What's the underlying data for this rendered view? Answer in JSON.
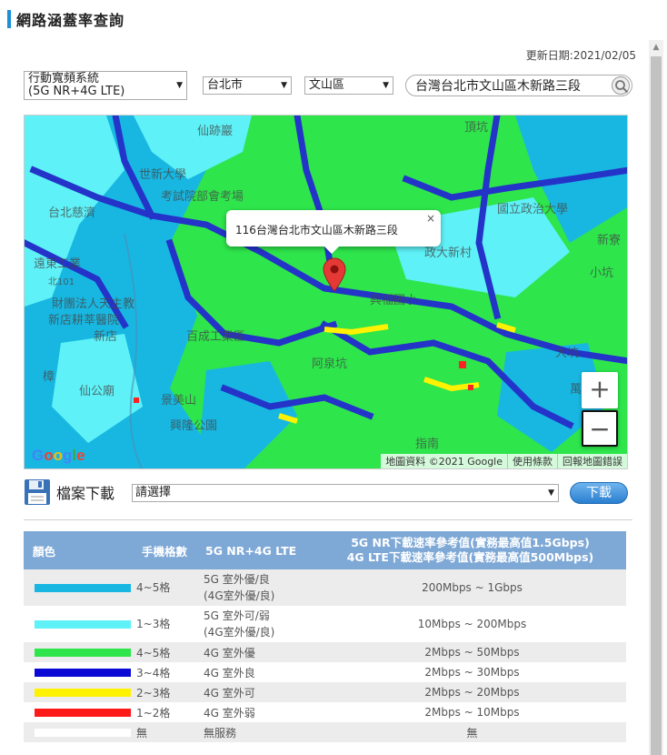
{
  "title": "網路涵蓋率查詢",
  "update_date": "更新日期:2021/02/05",
  "controls": {
    "system_line1": "行動寬頻系統",
    "system_line2": "(5G NR+4G LTE)",
    "city": "台北市",
    "district": "文山區",
    "search_value": "台灣台北市文山區木新路三段"
  },
  "map": {
    "popup_text": "116台灣台北市文山區木新路三段",
    "close_glyph": "×",
    "zoom_in": "+",
    "zoom_out": "−",
    "google_logo": "Google",
    "attribution": [
      "地圖資料 ©2021 Google",
      "使用條款",
      "回報地圖錯誤"
    ],
    "labels": [
      "仙跡巖",
      "世新大學",
      "考試院部會考場",
      "台北慈濟",
      "國立政治大學",
      "遠東工業",
      "北101",
      "財團法人天主教",
      "新店耕莘醫院",
      "新店",
      "政大新村",
      "小坑",
      "新寮",
      "大坑",
      "興福國小",
      "萬芳",
      "仙公廟",
      "樟",
      "阿泉坑",
      "頂坑",
      "景美山",
      "興隆公園",
      "指南",
      "百成工業區"
    ],
    "colors": {
      "light_blue": "#18b7e2",
      "cyan": "#5ef1f7",
      "green": "#2ee54c",
      "blue": "#2433c8",
      "yellow": "#fff200",
      "red": "#ff2222",
      "white": "#ffffff"
    }
  },
  "download": {
    "label": "檔案下載",
    "select_placeholder": "請選擇",
    "button": "下載"
  },
  "legend": {
    "headers": [
      "顏色",
      "手機格數",
      "5G NR+4G LTE",
      "5G NR下載速率參考值(實務最高值1.5Gbps)",
      "4G LTE下載速率參考值(實務最高值500Mbps)"
    ],
    "rows": [
      {
        "color": "#18b7e2",
        "bars": "4~5格",
        "tech": "5G 室外優/良",
        "tech2": "(4G室外優/良)",
        "speed": "200Mbps ~ 1Gbps"
      },
      {
        "color": "#5ef1f7",
        "bars": "1~3格",
        "tech": "5G 室外可/弱",
        "tech2": "(4G室外優/良)",
        "speed": "10Mbps ~ 200Mbps"
      },
      {
        "color": "#2ee54c",
        "bars": "4~5格",
        "tech": "4G 室外優",
        "tech2": "",
        "speed": "2Mbps ~ 50Mbps"
      },
      {
        "color": "#0a0ad4",
        "bars": "3~4格",
        "tech": "4G 室外良",
        "tech2": "",
        "speed": "2Mbps ~ 30Mbps"
      },
      {
        "color": "#fff200",
        "bars": "2~3格",
        "tech": "4G 室外可",
        "tech2": "",
        "speed": "2Mbps ~ 20Mbps"
      },
      {
        "color": "#ff1a1a",
        "bars": "1~2格",
        "tech": "4G 室外弱",
        "tech2": "",
        "speed": "2Mbps ~ 10Mbps"
      },
      {
        "color": "#ffffff",
        "bars": "無",
        "tech": "無服務",
        "tech2": "",
        "speed": "無"
      }
    ]
  }
}
